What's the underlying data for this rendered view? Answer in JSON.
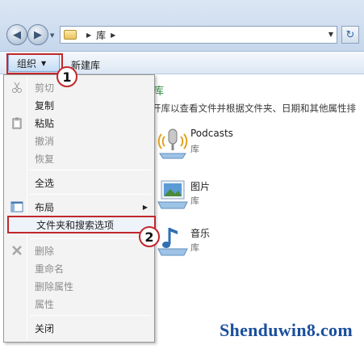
{
  "address_bar": {
    "path": [
      "库"
    ],
    "refresh_icon": "refresh-icon"
  },
  "toolbar": {
    "organize_label": "组织",
    "new_library_label": "新建库"
  },
  "menu": {
    "items": [
      {
        "label": "剪切",
        "icon": "scissors-icon",
        "disabled": true
      },
      {
        "label": "复制",
        "icon": null,
        "disabled": false
      },
      {
        "label": "粘贴",
        "icon": "clipboard-icon",
        "disabled": false
      },
      {
        "label": "撤消",
        "icon": null,
        "disabled": true
      },
      {
        "label": "恢复",
        "icon": null,
        "disabled": true
      },
      {
        "label": "全选",
        "icon": null,
        "disabled": false
      },
      {
        "label": "布局",
        "icon": "layout-icon",
        "disabled": false,
        "submenu": true
      },
      {
        "label": "文件夹和搜索选项",
        "icon": null,
        "disabled": false,
        "highlighted": true
      },
      {
        "label": "删除",
        "icon": "delete-x-icon",
        "disabled": true
      },
      {
        "label": "重命名",
        "icon": null,
        "disabled": true
      },
      {
        "label": "删除属性",
        "icon": null,
        "disabled": true
      },
      {
        "label": "属性",
        "icon": null,
        "disabled": true
      },
      {
        "label": "关闭",
        "icon": null,
        "disabled": false
      }
    ]
  },
  "content": {
    "title": "库",
    "description": "开库以查看文件并根据文件夹、日期和其他属性排",
    "libraries": [
      {
        "name": "Podcasts",
        "type": "库",
        "icon": "podcast-microphone-icon"
      },
      {
        "name": "图片",
        "type": "库",
        "icon": "pictures-library-icon"
      },
      {
        "name": "音乐",
        "type": "库",
        "icon": "music-library-icon"
      }
    ]
  },
  "annotations": {
    "step1": "1",
    "step2": "2",
    "accent_color": "#c0282c"
  },
  "watermark": "Shenduwin8.com"
}
